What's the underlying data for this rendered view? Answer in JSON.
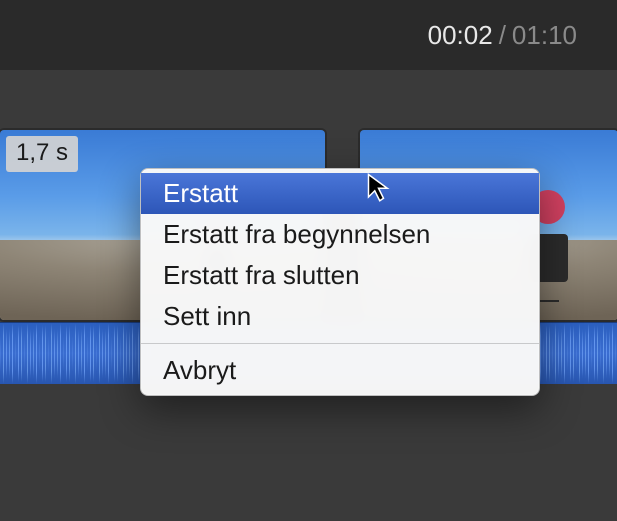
{
  "timecode": {
    "current": "00:02",
    "separator": "/",
    "total": "01:10"
  },
  "clips": {
    "left": {
      "duration_label": "1,7 s"
    }
  },
  "menu": {
    "items": [
      {
        "label": "Erstatt",
        "highlighted": true
      },
      {
        "label": "Erstatt fra begynnelsen",
        "highlighted": false
      },
      {
        "label": "Erstatt fra slutten",
        "highlighted": false
      },
      {
        "label": "Sett inn",
        "highlighted": false
      }
    ],
    "cancel_label": "Avbryt"
  }
}
